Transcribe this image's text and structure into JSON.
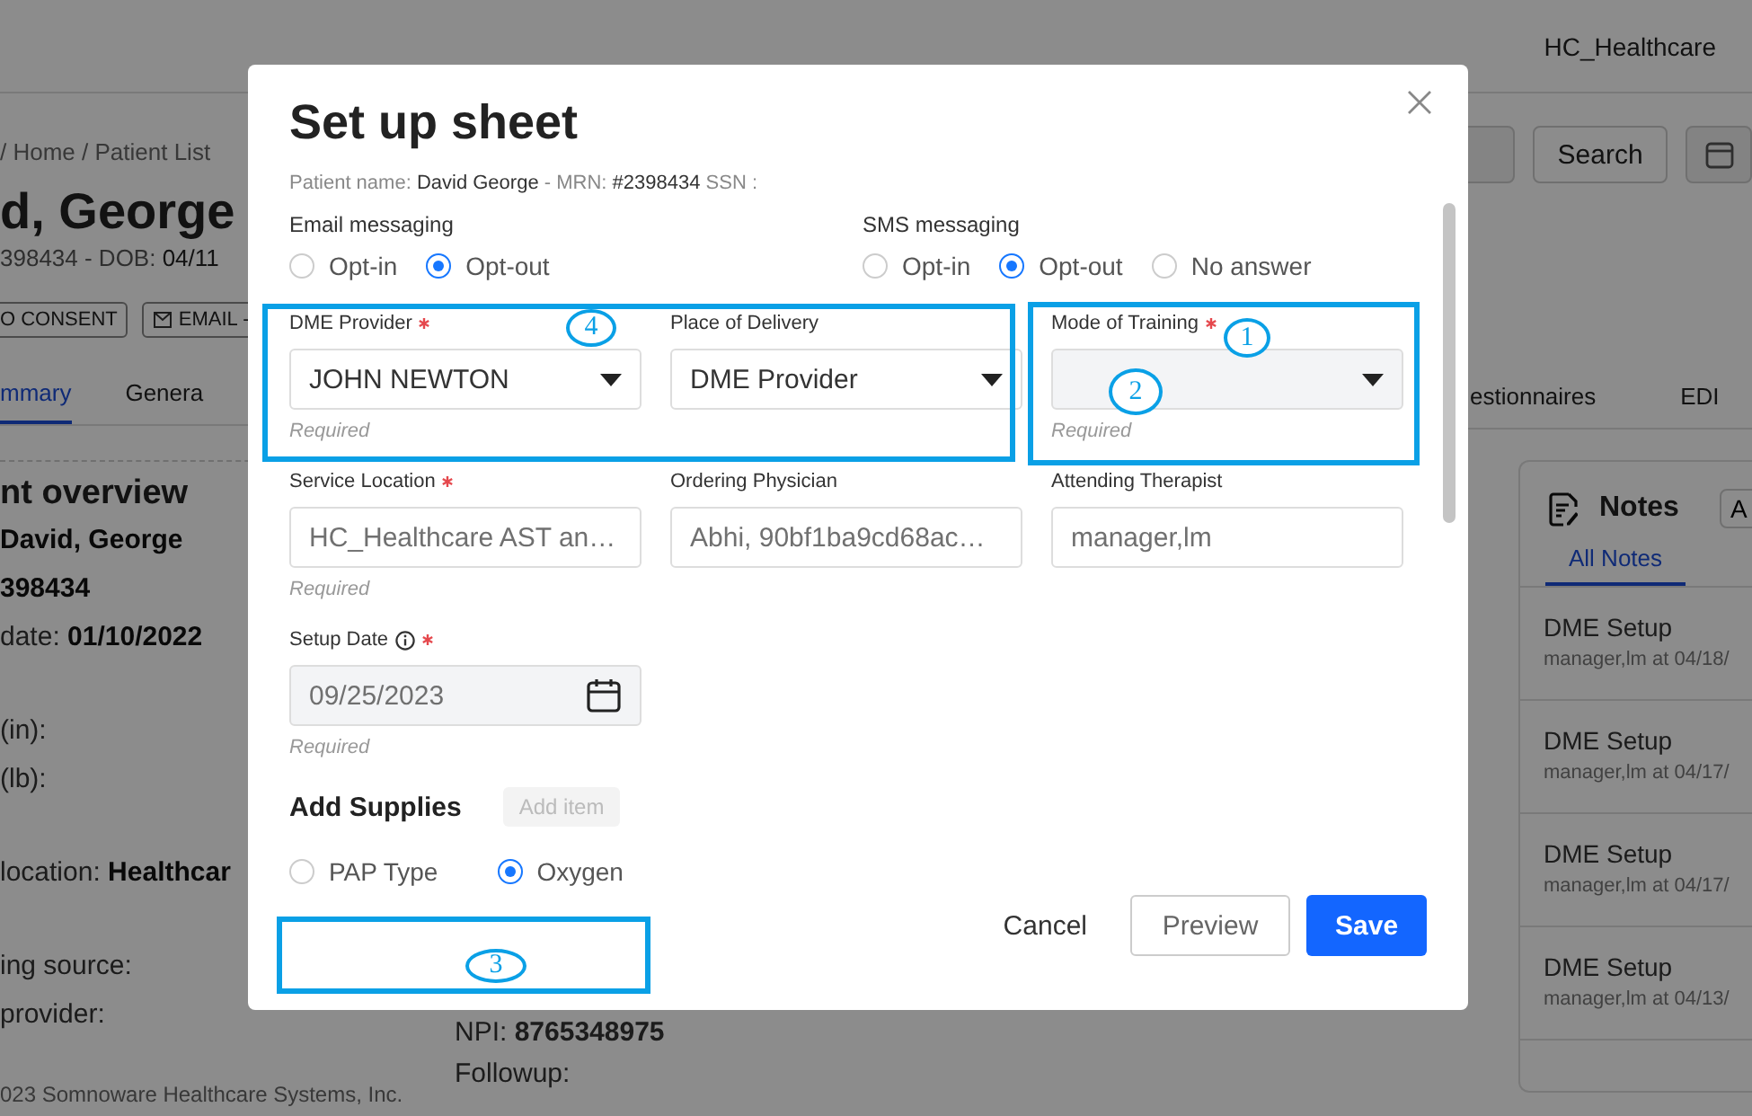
{
  "header": {
    "account": "HC_Healthcare"
  },
  "breadcrumb": "/ Home / Patient List",
  "patient": {
    "name": "d, George",
    "meta": "398434  - DOB: **04/11**",
    "badges": [
      {
        "label": "O CONSENT",
        "icon": false
      },
      {
        "label": "EMAIL -",
        "icon": true
      }
    ]
  },
  "search": {
    "button": "Search"
  },
  "tabs": [
    {
      "label": "mmary",
      "selected": true
    },
    {
      "label": "Genera",
      "selected": false
    }
  ],
  "right_tabs": [
    {
      "label": "estionnaires",
      "selected": false
    },
    {
      "label": "EDI",
      "selected": false
    }
  ],
  "overview": {
    "title": "nt overview",
    "groups": [
      [
        "**David, George**",
        "**398434**",
        "date: **01/10/2022**"
      ],
      [
        "(in):",
        "(lb):"
      ],
      [
        "location: **Healthcar**"
      ],
      [
        "ing source:",
        "provider:"
      ]
    ]
  },
  "middle": [
    "NPI: **8765348975**",
    "Followup:"
  ],
  "footer": "023 Somnoware Healthcare Systems, Inc.",
  "notes": {
    "title": "Notes",
    "filter_button": "A",
    "tabs": [
      {
        "label": "All Notes",
        "selected": true
      }
    ],
    "items": [
      {
        "title": "DME Setup",
        "meta": "manager,lm at 04/18/"
      },
      {
        "title": "DME Setup",
        "meta": "manager,lm at 04/17/"
      },
      {
        "title": "DME Setup",
        "meta": "manager,lm at 04/17/"
      },
      {
        "title": "DME Setup",
        "meta": "manager,lm at 04/13/"
      }
    ]
  },
  "modal": {
    "title": "Set up sheet",
    "subtitle": "Patient name: **David George** - MRN: **#2398434** SSN :",
    "email": {
      "label": "Email messaging",
      "options": [
        {
          "label": "Opt-in",
          "selected": false
        },
        {
          "label": "Opt-out",
          "selected": true
        }
      ]
    },
    "sms": {
      "label": "SMS messaging",
      "options": [
        {
          "label": "Opt-in",
          "selected": false
        },
        {
          "label": "Opt-out",
          "selected": true
        },
        {
          "label": "No answer",
          "selected": false
        }
      ]
    },
    "fields": [
      {
        "label": "DME Provider",
        "required": true,
        "kind": "select",
        "value": "JOHN NEWTON",
        "hint": "Required",
        "disabled": false
      },
      {
        "label": "Place of Delivery",
        "required": false,
        "kind": "select",
        "value": "DME Provider",
        "disabled": false
      },
      {
        "label": "Mode of Training",
        "required": true,
        "kind": "select",
        "hint": "Required",
        "disabled": true
      },
      {
        "label": "Service Location",
        "required": true,
        "kind": "text",
        "value": "HC_Healthcare AST an…",
        "hint": "Required",
        "disabled": false
      },
      {
        "label": "Ordering Physician",
        "required": false,
        "kind": "text",
        "value": "Abhi, 90bf1ba9cd68ac…",
        "disabled": false
      },
      {
        "label": "Attending Therapist",
        "required": false,
        "kind": "text",
        "value": "manager,lm",
        "disabled": false
      },
      {
        "label": "Setup Date",
        "info": true,
        "required": true,
        "kind": "date",
        "value": "09/25/2023",
        "hint": "Required",
        "disabled": true
      }
    ],
    "supplies": {
      "title": "Add Supplies",
      "add_button": "Add item",
      "add_disabled": true,
      "types": [
        {
          "label": "PAP Type",
          "selected": false
        },
        {
          "label": "Oxygen",
          "selected": true
        }
      ]
    },
    "buttons": [
      {
        "label": "Cancel",
        "kind": "link"
      },
      {
        "label": "Preview",
        "kind": "secondary"
      },
      {
        "label": "Save",
        "kind": "primary"
      }
    ]
  },
  "annotations": [
    {
      "kind": "frame"
    },
    {
      "kind": "frame"
    },
    {
      "kind": "frame"
    },
    {
      "kind": "marker",
      "label": "4"
    },
    {
      "kind": "marker",
      "label": "1"
    },
    {
      "kind": "marker",
      "label": "2"
    },
    {
      "kind": "marker",
      "label": "3"
    }
  ]
}
